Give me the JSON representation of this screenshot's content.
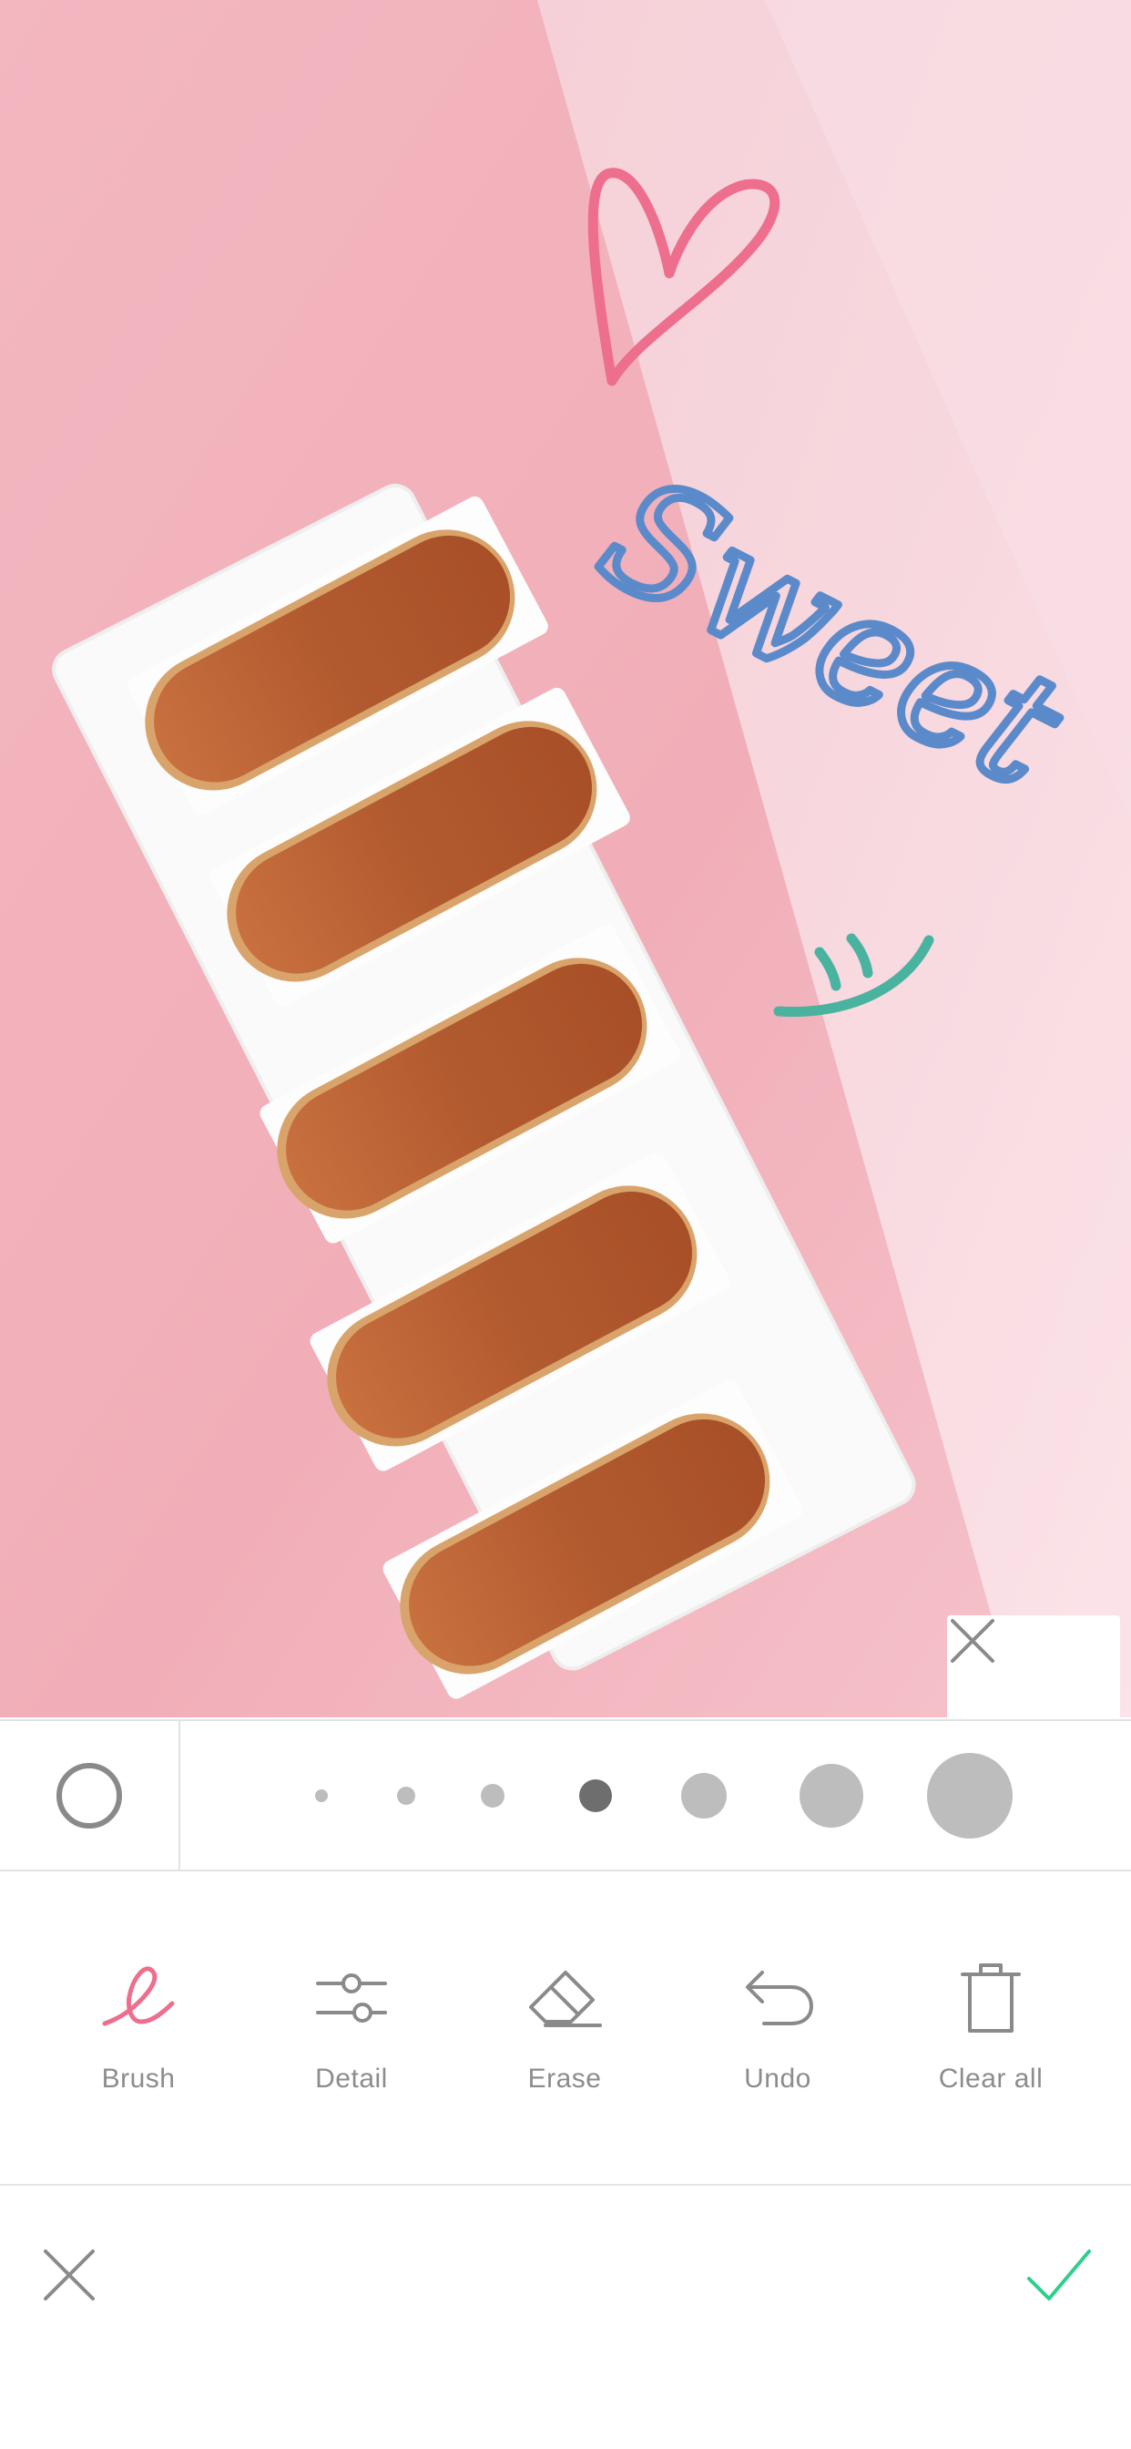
{
  "editor": {
    "mode": "doodle",
    "doodle_text": "Sweet",
    "doodle_colors": {
      "heart": "#ee6e8d",
      "text": "#5b8acb",
      "smile": "#49b39f"
    },
    "hide_panel_icon": "close-icon"
  },
  "brush_panel": {
    "color_icon": "circle-outline-icon",
    "selected_size_index": 3,
    "size_count": 7
  },
  "tools": [
    {
      "label": "Brush",
      "icon": "brush-icon",
      "active": true
    },
    {
      "label": "Detail",
      "icon": "sliders-icon",
      "active": false
    },
    {
      "label": "Erase",
      "icon": "eraser-icon",
      "active": false
    },
    {
      "label": "Undo",
      "icon": "undo-icon",
      "active": false
    },
    {
      "label": "Clear all",
      "icon": "trash-icon",
      "active": false
    }
  ],
  "colors": {
    "accent_pink": "#ee6e8d",
    "confirm_green": "#2ecf8b",
    "icon_gray": "#8a8a8a"
  },
  "footer": {
    "cancel_icon": "close-icon",
    "confirm_icon": "check-icon"
  }
}
